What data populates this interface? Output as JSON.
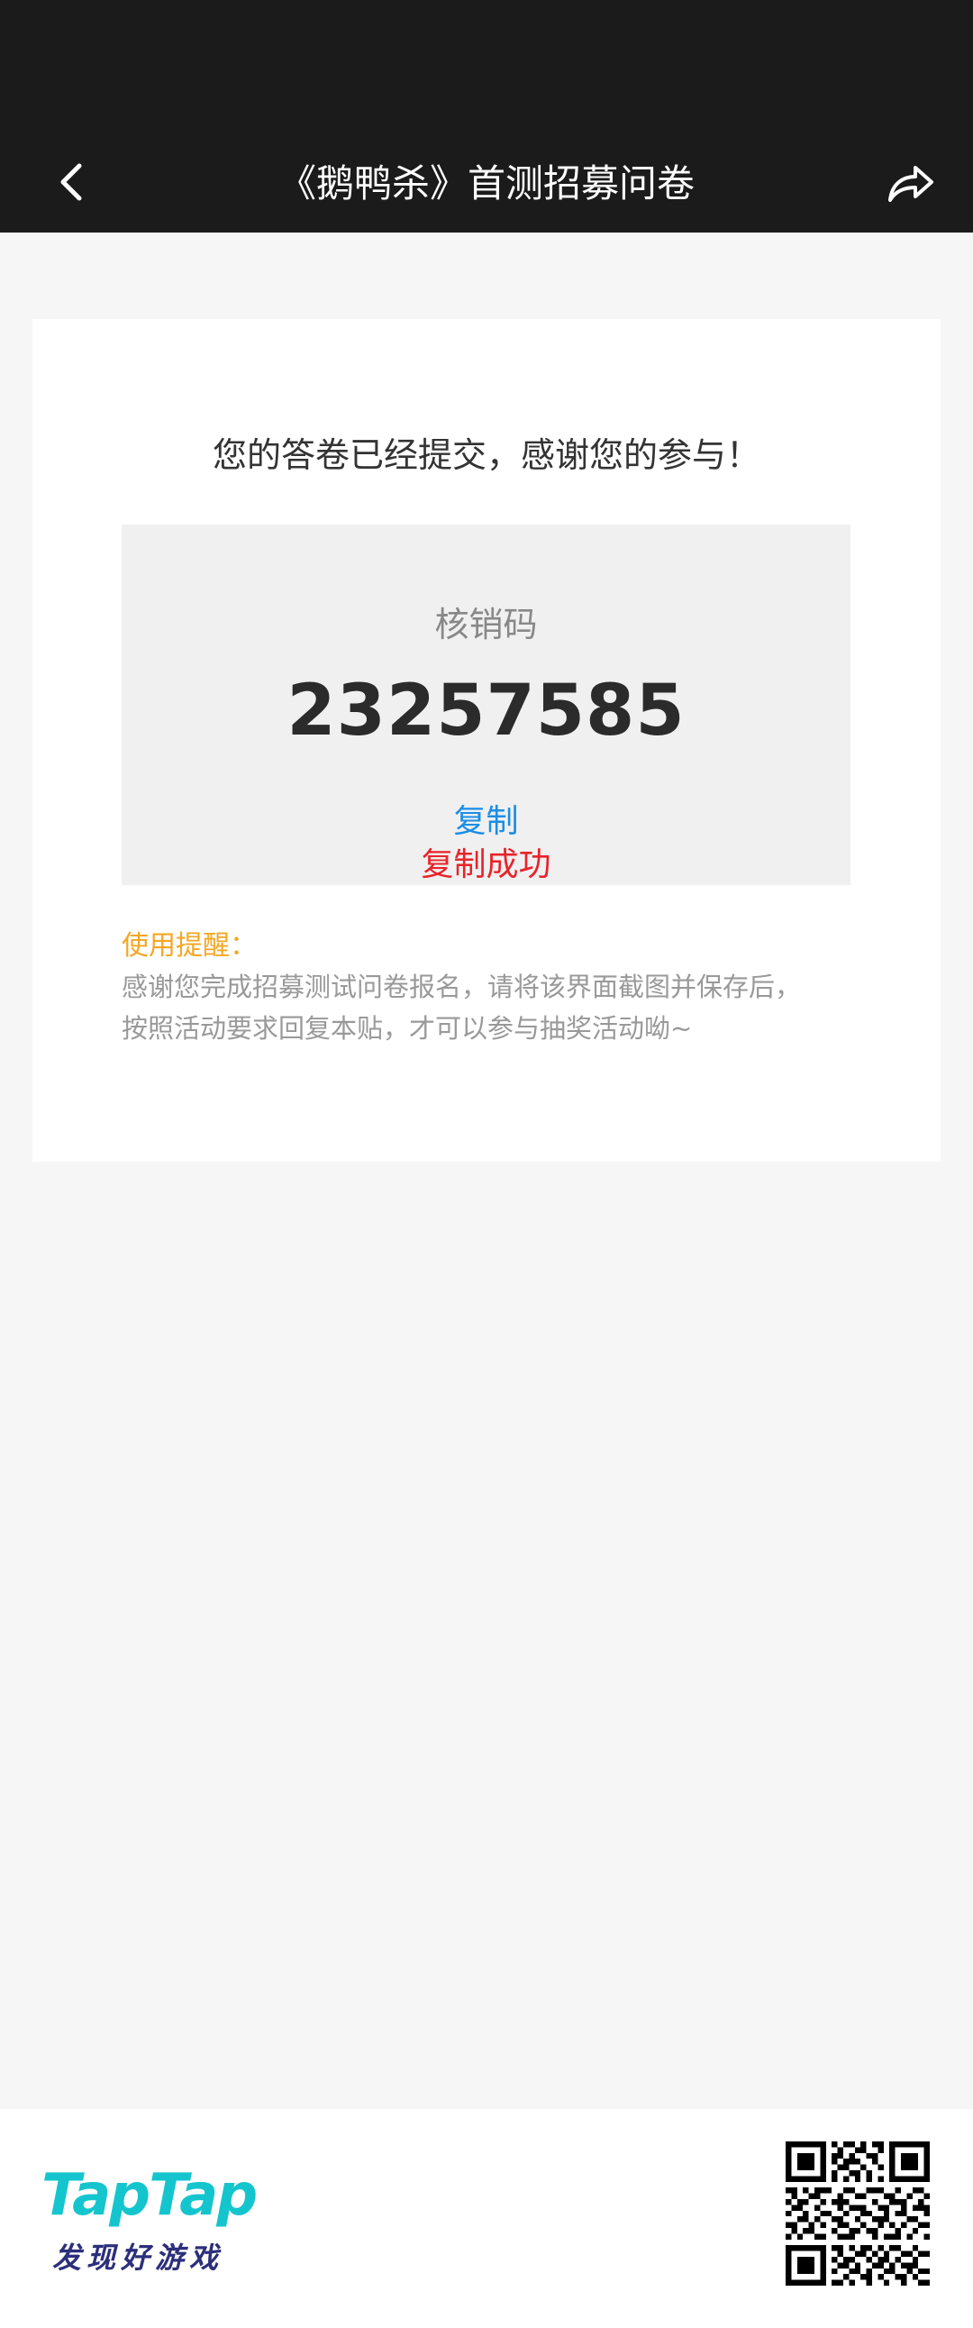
{
  "nav": {
    "title": "《鹅鸭杀》首测招募问卷",
    "back_icon": "chevron-left-icon",
    "share_icon": "share-icon"
  },
  "card": {
    "thanks": "您的答卷已经提交，感谢您的参与！",
    "code_label": "核销码",
    "code_value": "23257585",
    "copy_label": "复制",
    "copy_success": "复制成功",
    "reminder_title": "使用提醒：",
    "reminder_line1": "感谢您完成招募测试问卷报名，请将该界面截图并保存后，",
    "reminder_line2": "按照活动要求回复本贴，才可以参与抽奖活动呦~"
  },
  "footer": {
    "logo_text": "TapTap",
    "slogan": "发现好游戏"
  },
  "colors": {
    "header_bg": "#1b1b1b",
    "page_bg": "#f6f6f6",
    "copy_link": "#1a8ee6",
    "copy_success": "#e8232a",
    "reminder_title": "#f5a623",
    "brand_teal": "#15c5ce",
    "brand_navy": "#2c2f7a"
  }
}
